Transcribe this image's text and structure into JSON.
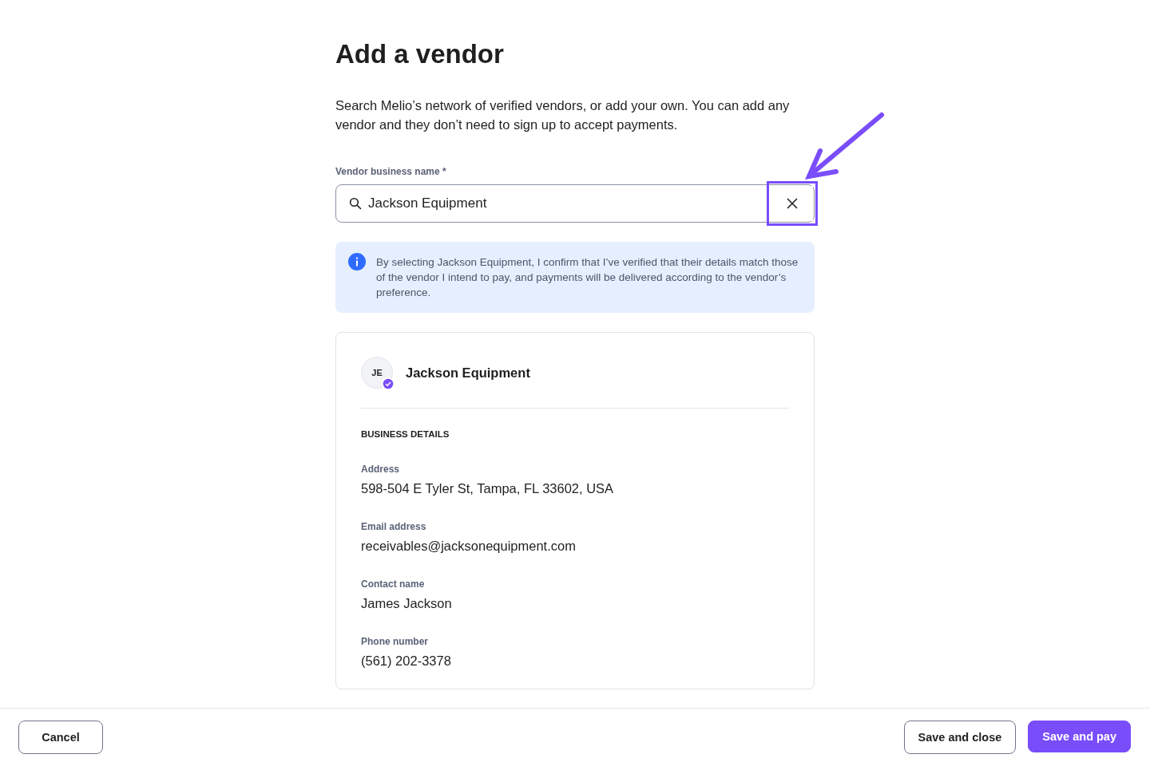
{
  "title": "Add a vendor",
  "intro": "Search Melio’s network of verified vendors, or add your own. You can add any vendor and they don’t need to sign up to accept payments.",
  "field": {
    "label": "Vendor business name *",
    "value": "Jackson Equipment"
  },
  "notice": "By selecting Jackson Equipment, I confirm that I’ve verified that their details match those of the vendor I intend to pay, and payments will be delivered according to the vendor’s preference.",
  "vendor": {
    "initials": "JE",
    "name": "Jackson Equipment",
    "verified": true
  },
  "section_heading": "BUSINESS DETAILS",
  "details": [
    {
      "label": "Address",
      "value": "598-504 E Tyler St, Tampa, FL 33602, USA"
    },
    {
      "label": "Email address",
      "value": "receivables@jacksonequipment.com"
    },
    {
      "label": "Contact name",
      "value": "James Jackson"
    },
    {
      "label": "Phone number",
      "value": "(561) 202-3378"
    }
  ],
  "footer": {
    "left": [
      {
        "label": "Cancel",
        "kind": "secondary"
      }
    ],
    "right": [
      {
        "label": "Save and close",
        "kind": "secondary"
      },
      {
        "label": "Save and pay",
        "kind": "primary"
      }
    ]
  }
}
